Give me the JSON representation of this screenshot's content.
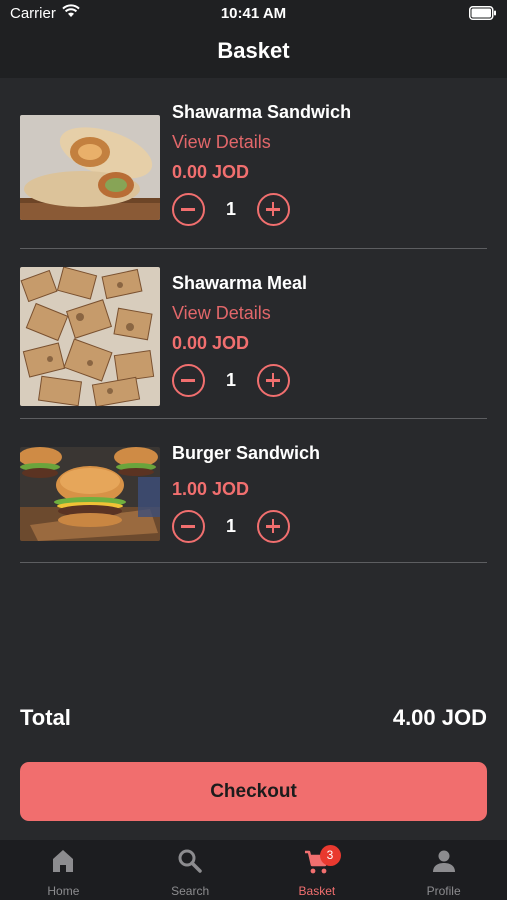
{
  "status_bar": {
    "carrier": "Carrier",
    "time": "10:41 AM"
  },
  "header": {
    "title": "Basket"
  },
  "items": [
    {
      "name": "Shawarma Sandwich",
      "details_label": "View Details",
      "price": "0.00 JOD",
      "quantity": "1",
      "image": "shawarma-wrap-photo"
    },
    {
      "name": "Shawarma Meal",
      "details_label": "View Details",
      "price": "0.00 JOD",
      "quantity": "1",
      "image": "shawarma-meal-photo"
    },
    {
      "name": "Burger Sandwich",
      "price": "1.00 JOD",
      "quantity": "1",
      "image": "burger-photo"
    }
  ],
  "summary": {
    "total_label": "Total",
    "total_value": "4.00 JOD"
  },
  "checkout": {
    "label": "Checkout"
  },
  "tabbar": {
    "tabs": [
      {
        "label": "Home",
        "icon": "home-icon"
      },
      {
        "label": "Search",
        "icon": "search-icon"
      },
      {
        "label": "Basket",
        "icon": "cart-icon",
        "badge": "3",
        "active": true
      },
      {
        "label": "Profile",
        "icon": "person-icon"
      }
    ]
  },
  "colors": {
    "accent": "#f16f6f",
    "background": "#28292c",
    "bar": "#1f2022",
    "badge": "#e9392f"
  }
}
